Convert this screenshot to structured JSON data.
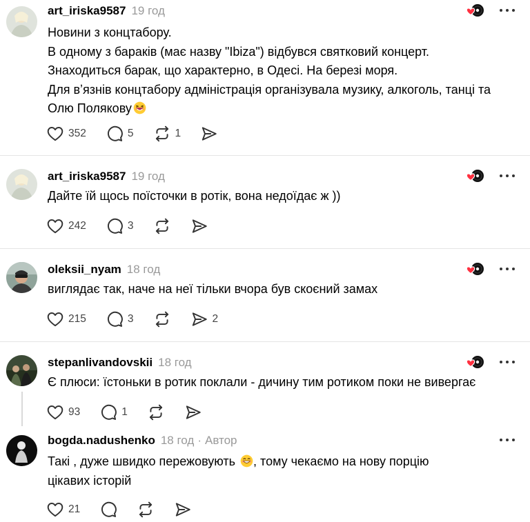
{
  "posts": [
    {
      "username": "art_iriska9587",
      "time": "19 год",
      "lines": [
        "Новини з концтабору.",
        "В одному з бараків (має назву \"Ibiza\") відбувся святковий концерт.",
        "Знаходиться барак, що характерно, в Одесі. На березі моря.",
        "Для вʼязнів концтабору адміністрація організувала музику, алкоголь, танці та",
        "Олю Полякову"
      ],
      "likes": "352",
      "replies": "5",
      "reposts": "1",
      "shares": ""
    },
    {
      "username": "art_iriska9587",
      "time": "19 год",
      "lines": [
        "Дайте їй щось поїсточки в ротік, вона недоїдає ж ))"
      ],
      "likes": "242",
      "replies": "3",
      "reposts": "",
      "shares": ""
    },
    {
      "username": "oleksii_nyam",
      "time": "18 год",
      "lines": [
        "виглядає так, наче на неї тільки вчора був скоєний замах"
      ],
      "likes": "215",
      "replies": "3",
      "reposts": "",
      "shares": "2"
    },
    {
      "username": "stepanlivandovskii",
      "time": "18 год",
      "lines": [
        "Є плюси: їстоньки в ротик поклали - дичину тим ротиком поки не вивергає"
      ],
      "likes": "93",
      "replies": "1",
      "reposts": "",
      "shares": ""
    },
    {
      "username": "bogda.nadushenko",
      "time": "18 год",
      "author_sep": "·",
      "author_label": "Автор",
      "lines": [
        "Такі , дуже швидко пережовують",
        "цікавих історій"
      ],
      "line1_tail": ", тому чекаємо на нову порцію",
      "likes": "21",
      "replies": "",
      "reposts": "",
      "shares": ""
    }
  ],
  "icons": {
    "like": "heart-icon",
    "reply": "comment-icon",
    "repost": "repost-icon",
    "share": "share-icon",
    "more": "more-icon",
    "badge": "music-vinyl-heart-badge"
  },
  "colors": {
    "username": "#000000",
    "meta": "#999999",
    "icon": "#333333",
    "divider": "#e5e5e5",
    "badge_heart": "#ff3040"
  }
}
